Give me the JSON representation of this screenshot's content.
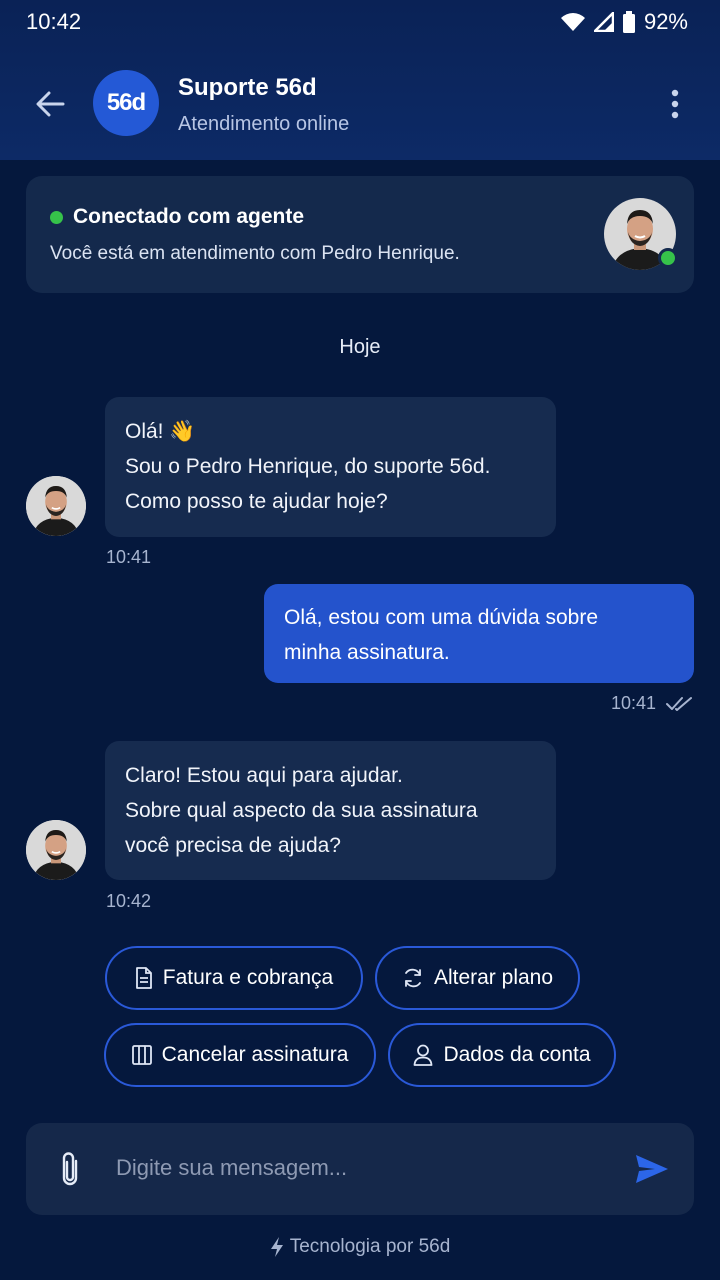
{
  "status_bar": {
    "time": "10:42",
    "battery": "92%"
  },
  "header": {
    "logo_text": "56d",
    "title": "Suporte 56d",
    "subtitle": "Atendimento online"
  },
  "agent_card": {
    "title": "Conectado com agente",
    "description": "Você está em atendimento com Pedro Henrique."
  },
  "date_separator": "Hoje",
  "messages": [
    {
      "direction": "in",
      "lines": [
        "Olá! 👋",
        "Sou o Pedro Henrique, do suporte 56d.",
        "Como posso te ajudar hoje?"
      ],
      "time": "10:41"
    },
    {
      "direction": "out",
      "lines": [
        "Olá, estou com uma dúvida sobre",
        "minha assinatura."
      ],
      "time": "10:41",
      "read": true
    },
    {
      "direction": "in",
      "lines": [
        "Claro! Estou aqui para ajudar.",
        "Sobre qual aspecto da sua assinatura",
        "você precisa de ajuda?"
      ],
      "time": "10:42"
    }
  ],
  "quick_replies": [
    {
      "label": "Fatura e cobrança",
      "icon": "document-icon"
    },
    {
      "label": "Alterar plano",
      "icon": "refresh-icon"
    },
    {
      "label": "Cancelar assinatura",
      "icon": "columns-icon"
    },
    {
      "label": "Dados da conta",
      "icon": "user-icon"
    }
  ],
  "composer": {
    "placeholder": "Digite sua mensagem..."
  },
  "footer": {
    "text": "Tecnologia por 56d"
  },
  "colors": {
    "background": "#05183d",
    "header": "#0d2a66",
    "bubble_in": "#162b4f",
    "bubble_out": "#2453cc",
    "accent": "#2a59d8",
    "online": "#36c24a"
  }
}
